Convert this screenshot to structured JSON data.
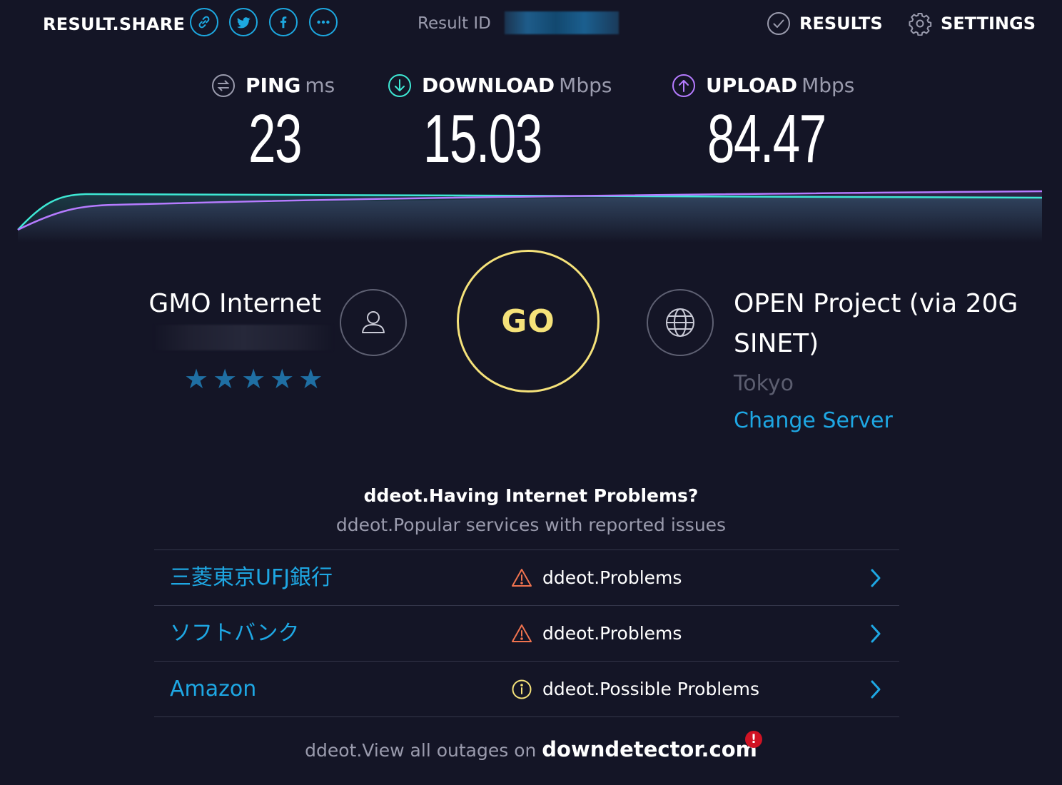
{
  "header": {
    "share_label": "RESULT.SHARE",
    "share_buttons": [
      "link-icon",
      "twitter-icon",
      "facebook-icon",
      "more-icon"
    ],
    "result_id_label": "Result ID",
    "nav": [
      {
        "label": "RESULTS",
        "icon": "check-circle-icon"
      },
      {
        "label": "SETTINGS",
        "icon": "gear-icon"
      }
    ]
  },
  "metrics": {
    "ping": {
      "label": "PING",
      "unit": "ms",
      "value": "23",
      "icon": "ping-icon"
    },
    "download": {
      "label": "DOWNLOAD",
      "unit": "Mbps",
      "value": "15.03",
      "icon": "download-icon",
      "color": "#3ee8d4"
    },
    "upload": {
      "label": "UPLOAD",
      "unit": "Mbps",
      "value": "84.47",
      "icon": "upload-icon",
      "color": "#b57bff"
    }
  },
  "isp": {
    "name": "GMO Internet",
    "stars": [
      "★",
      "★",
      "★",
      "★",
      "★"
    ]
  },
  "go_label": "GO",
  "server": {
    "name": "OPEN Project (via 20G SINET)",
    "location": "Tokyo",
    "change_label": "Change Server"
  },
  "problems": {
    "title": "ddeot.Having Internet Problems?",
    "subtitle": "ddeot.Popular services with reported issues",
    "rows": [
      {
        "service": "三菱東京UFJ銀行",
        "status": "ddeot.Problems",
        "level": "problems"
      },
      {
        "service": "ソフトバンク",
        "status": "ddeot.Problems",
        "level": "problems"
      },
      {
        "service": "Amazon",
        "status": "ddeot.Possible Problems",
        "level": "possible"
      }
    ]
  },
  "footer": {
    "text": "ddeot.View all outages on",
    "site": "downdetector.com",
    "badge": "!"
  },
  "colors": {
    "background": "#141526",
    "accent_blue": "#1ea7e3",
    "go_yellow": "#f5e27a",
    "warning_orange": "#f0734f",
    "possible_yellow": "#f5e27a"
  }
}
